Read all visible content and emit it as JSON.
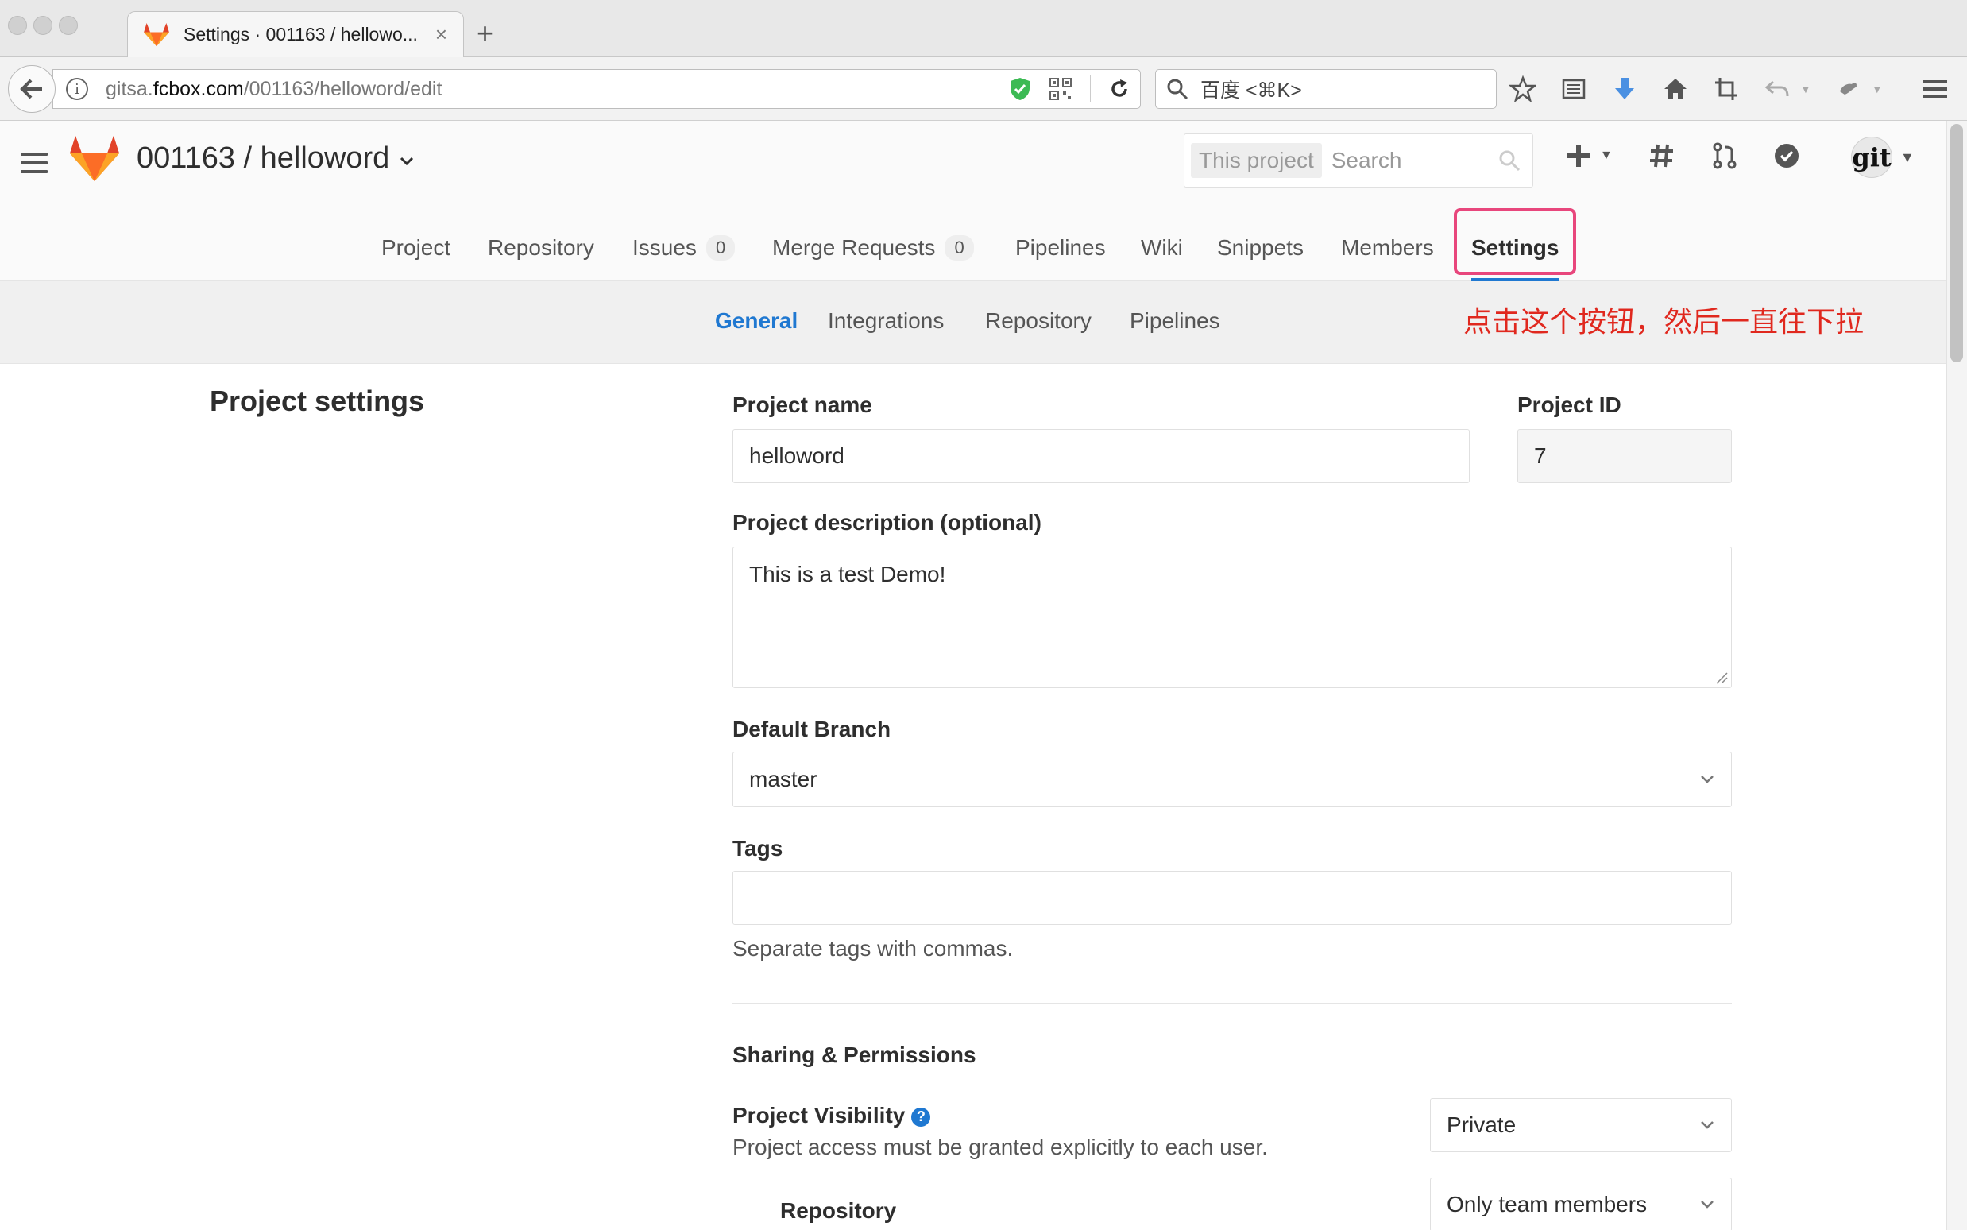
{
  "browser": {
    "tab_title": "Settings · 001163 / hellowo...",
    "tab_close": "×",
    "new_tab": "+",
    "url_prefix": "gitsa.",
    "url_domain": "fcbox.com",
    "url_path": "/001163/helloword/edit",
    "search_placeholder": "百度 <⌘K>"
  },
  "gitlab": {
    "project_title": "001163 / helloword",
    "search_scope": "This project",
    "search_placeholder": "Search",
    "avatar_text": "git",
    "nav_tabs": [
      {
        "label": "Project"
      },
      {
        "label": "Repository"
      },
      {
        "label": "Issues",
        "count": "0"
      },
      {
        "label": "Merge Requests",
        "count": "0"
      },
      {
        "label": "Pipelines"
      },
      {
        "label": "Wiki"
      },
      {
        "label": "Snippets"
      },
      {
        "label": "Members"
      },
      {
        "label": "Settings",
        "active": true
      }
    ],
    "sub_tabs": [
      {
        "label": "General",
        "active": true
      },
      {
        "label": "Integrations"
      },
      {
        "label": "Repository"
      },
      {
        "label": "Pipelines"
      }
    ],
    "annotation": "点击这个按钮，然后一直往下拉"
  },
  "settings": {
    "section_title": "Project settings",
    "project_name_label": "Project name",
    "project_name_value": "helloword",
    "project_id_label": "Project ID",
    "project_id_value": "7",
    "description_label": "Project description (optional)",
    "description_value": "This is a test Demo!",
    "default_branch_label": "Default Branch",
    "default_branch_value": "master",
    "tags_label": "Tags",
    "tags_value": "",
    "tags_help": "Separate tags with commas.",
    "sharing_title": "Sharing & Permissions",
    "visibility_label": "Project Visibility",
    "visibility_help_icon": "?",
    "visibility_help": "Project access must be granted explicitly to each user.",
    "visibility_value": "Private",
    "repository_label": "Repository",
    "repository_value": "Only team members"
  },
  "colors": {
    "accent": "#1f78d1",
    "highlight_border": "#e8467c",
    "annotation": "#e0281e"
  }
}
